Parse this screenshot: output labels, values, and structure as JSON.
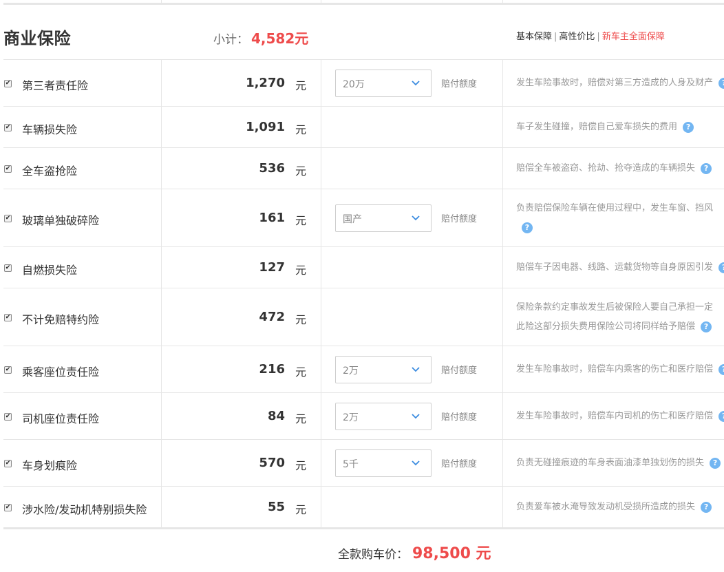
{
  "section": {
    "title": "商业保险",
    "subtotal_label": "小计：",
    "subtotal_value": "4,582元"
  },
  "plans": {
    "basic": "基本保障",
    "value": "高性价比",
    "full": "新车主全面保障",
    "separator": "|"
  },
  "checkbox_mark": "✔",
  "coverage_label": "赔付额度",
  "help_glyph": "?",
  "chevron_icon": "chevron-down-icon",
  "colors": {
    "accent": "#ee4b4b",
    "help": "#73b6f2",
    "border": "#e6e6e6"
  },
  "items": [
    {
      "name": "第三者责任险",
      "price": "1,270",
      "unit": "元",
      "option": "20万",
      "desc": [
        "发生车险事故时，赔偿对第三方造成的人身及财产"
      ]
    },
    {
      "name": "车辆损失险",
      "price": "1,091",
      "unit": "元",
      "option": null,
      "desc": [
        "车子发生碰撞，赔偿自己爱车损失的费用"
      ]
    },
    {
      "name": "全车盗抢险",
      "price": "536",
      "unit": "元",
      "option": null,
      "desc": [
        "赔偿全车被盗窃、抢劫、抢夺造成的车辆损失"
      ]
    },
    {
      "name": "玻璃单独破碎险",
      "price": "161",
      "unit": "元",
      "option": "国产",
      "desc": [
        "负责赔偿保险车辆在使用过程中，发生车窗、挡风",
        ""
      ]
    },
    {
      "name": "自燃损失险",
      "price": "127",
      "unit": "元",
      "option": null,
      "desc": [
        "赔偿车子因电器、线路、运载货物等自身原因引发"
      ]
    },
    {
      "name": "不计免赔特约险",
      "price": "472",
      "unit": "元",
      "option": null,
      "desc": [
        "保险条款约定事故发生后被保险人要自己承担一定",
        "此险这部分损失费用保险公司将同样给予赔偿"
      ]
    },
    {
      "name": "乘客座位责任险",
      "price": "216",
      "unit": "元",
      "option": "2万",
      "desc": [
        "发生车险事故时，赔偿车内乘客的伤亡和医疗赔偿"
      ]
    },
    {
      "name": "司机座位责任险",
      "price": "84",
      "unit": "元",
      "option": "2万",
      "desc": [
        "发生车险事故时，赔偿车内司机的伤亡和医疗赔偿"
      ]
    },
    {
      "name": "车身划痕险",
      "price": "570",
      "unit": "元",
      "option": "5千",
      "desc": [
        "负责无碰撞痕迹的车身表面油漆单独划伤的损失"
      ]
    },
    {
      "name": "涉水险/发动机特别损失险",
      "price": "55",
      "unit": "元",
      "option": null,
      "desc": [
        "负责爱车被水淹导致发动机受损所造成的损失"
      ]
    }
  ],
  "total": {
    "label": "全款购车价：",
    "value": "98,500 元"
  }
}
